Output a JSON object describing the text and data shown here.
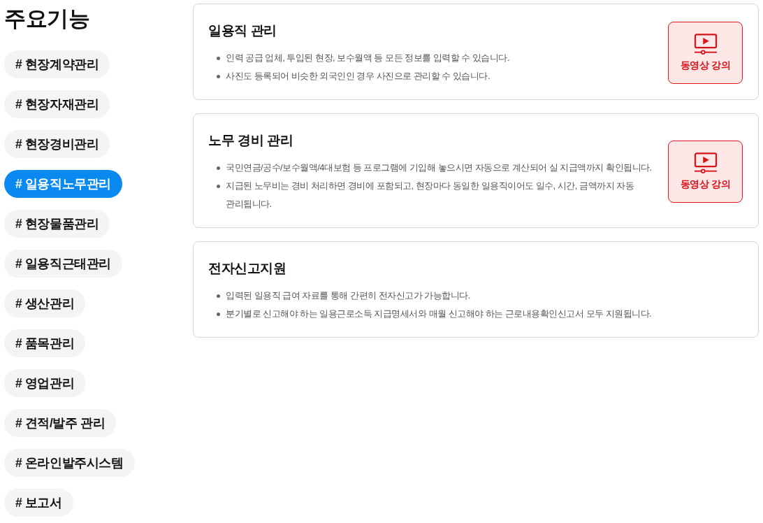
{
  "sidebar": {
    "title": "주요기능",
    "items": [
      {
        "label": "# 현장계약관리",
        "selected": false
      },
      {
        "label": "# 현장자재관리",
        "selected": false
      },
      {
        "label": "# 현장경비관리",
        "selected": false
      },
      {
        "label": "# 일용직노무관리",
        "selected": true
      },
      {
        "label": "# 현장물품관리",
        "selected": false
      },
      {
        "label": "# 일용직근태관리",
        "selected": false
      },
      {
        "label": "# 생산관리",
        "selected": false
      },
      {
        "label": "# 품목관리",
        "selected": false
      },
      {
        "label": "# 영업관리",
        "selected": false
      },
      {
        "label": "# 견적/발주 관리",
        "selected": false
      },
      {
        "label": "# 온라인발주시스템",
        "selected": false
      },
      {
        "label": "# 보고서",
        "selected": false
      }
    ]
  },
  "features": [
    {
      "title": "일용직 관리",
      "bullets": [
        "인력 공급 업체, 투입된 현장, 보수월액 등 모든 정보를 입력할 수 있습니다.",
        "사진도 등록되어 비슷한 외국인인 경우 사진으로 관리할 수 있습니다."
      ],
      "video_button": "동영상 강의"
    },
    {
      "title": "노무 경비 관리",
      "bullets": [
        "국민연금/공수/보수월액/4대보험 등 프로그램에 기입해 놓으시면 자동으로 계산되어 실 지급액까지 확인됩니다.",
        "지급된 노무비는 경비 처리하면 경비에 포함되고, 현장마다 동일한 일용직이어도 일수, 시간, 금액까지 자동 관리됩니다."
      ],
      "video_button": "동영상 강의"
    },
    {
      "title": "전자신고지원",
      "bullets": [
        "입력된 일용직 급여 자료를 통해 간편히 전자신고가 가능합니다.",
        "분기별로 신고해야 하는 일용근로소득 지급명세서와 매월 신고해야 하는 근로내용확인신고서 모두 지원됩니다."
      ]
    }
  ]
}
